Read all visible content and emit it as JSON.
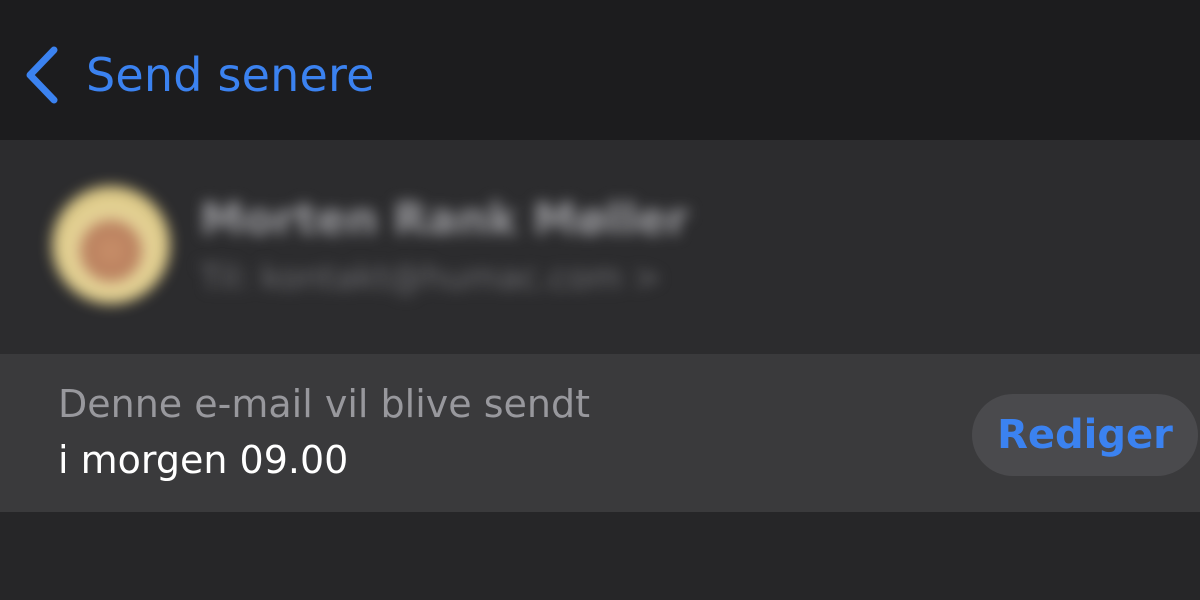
{
  "nav": {
    "back_label": "Send senere"
  },
  "sender": {
    "name": "Morten Rank Møller",
    "recipient": "Til: kontakt@humac.com >"
  },
  "schedule": {
    "caption": "Denne e-mail vil blive sendt",
    "time": "i morgen 09.00",
    "edit_label": "Rediger"
  },
  "colors": {
    "accent": "#3b82f0",
    "nav_background": "#1c1c1e",
    "card_background": "#2c2c2e",
    "row_background": "#3a3a3c"
  },
  "icons": {
    "back": "chevron-left-icon"
  }
}
